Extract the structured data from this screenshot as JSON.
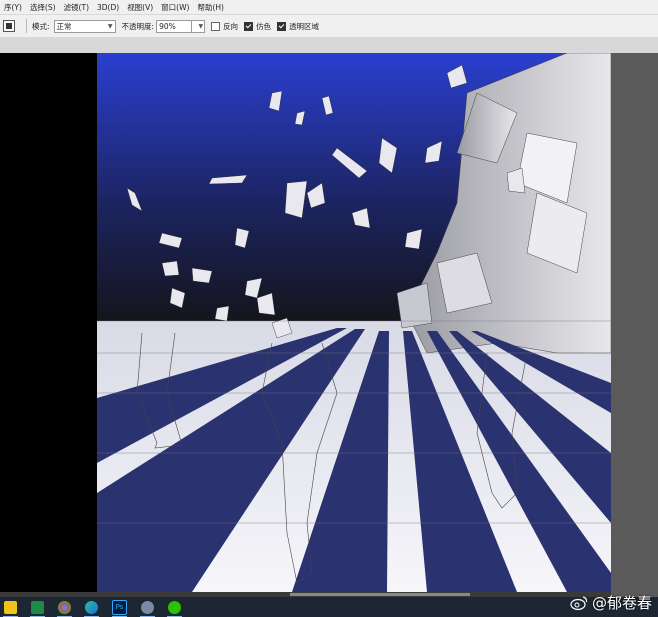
{
  "menubar": {
    "items": [
      "序(Y)",
      "选择(S)",
      "滤镜(T)",
      "3D(D)",
      "视图(V)",
      "窗口(W)",
      "帮助(H)"
    ]
  },
  "options": {
    "mode_label": "模式:",
    "mode_value": "正常",
    "opacity_label": "不透明度:",
    "opacity_value": "90%",
    "reverse_label": "反向",
    "reverse_checked": false,
    "dither_label": "仿色",
    "dither_checked": true,
    "transparency_label": "透明区域",
    "transparency_checked": true
  },
  "canvas": {
    "sky_top": "#2a3fd0",
    "sky_bottom": "#141418",
    "stripe_dark": "#2a3270",
    "ground_light": "#f4f4f8"
  },
  "taskbar": {
    "icons": [
      "file-explorer-icon",
      "excel-icon",
      "chrome-icon",
      "edge-icon",
      "photoshop-icon",
      "settings-icon",
      "wechat-icon"
    ],
    "ps_label": "Ps"
  },
  "watermark": {
    "text": "@郁卷春"
  }
}
